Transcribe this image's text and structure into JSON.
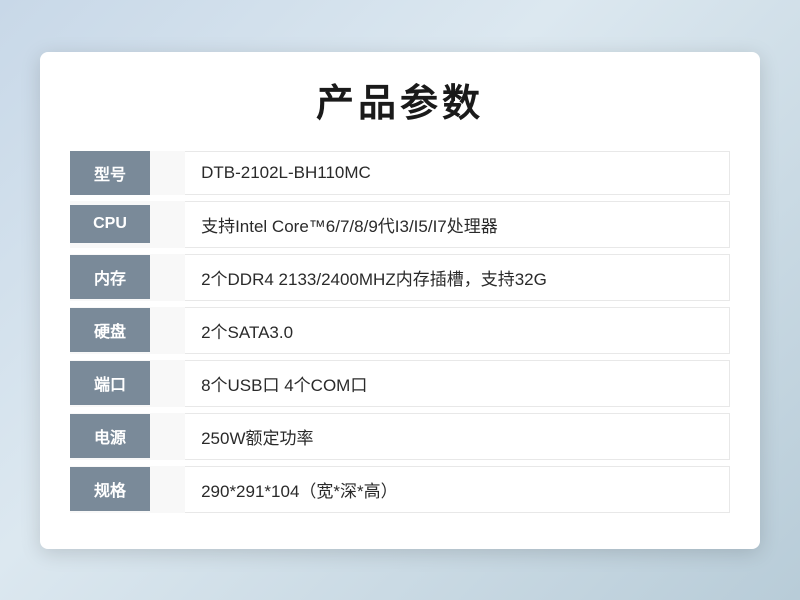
{
  "page": {
    "title": "产品参数",
    "specs": [
      {
        "id": "model",
        "label": "型号",
        "value": " DTB-2102L-BH110MC"
      },
      {
        "id": "cpu",
        "label": "CPU",
        "value": " 支持Intel Core™6/7/8/9代I3/I5/I7处理器"
      },
      {
        "id": "memory",
        "label": "内存",
        "value": " 2个DDR4 2133/2400MHZ内存插槽，支持32G"
      },
      {
        "id": "storage",
        "label": "硬盘",
        "value": " 2个SATA3.0"
      },
      {
        "id": "ports",
        "label": "端口",
        "value": " 8个USB口 4个COM口"
      },
      {
        "id": "power",
        "label": "电源",
        "value": " 250W额定功率"
      },
      {
        "id": "size",
        "label": "规格",
        "value": " 290*291*104（宽*深*高）"
      }
    ]
  }
}
